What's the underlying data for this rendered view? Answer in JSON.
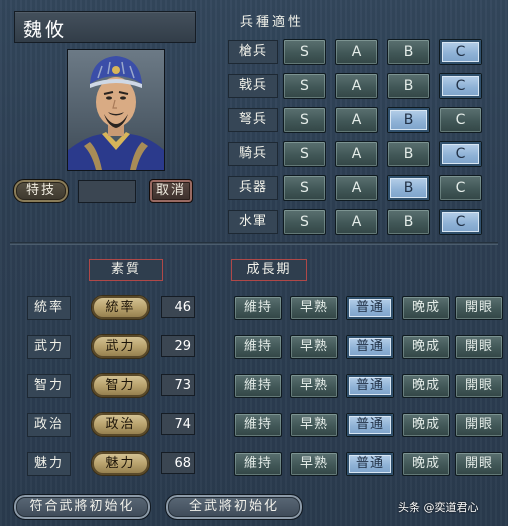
{
  "general": {
    "name": "魏攸"
  },
  "buttons": {
    "special_skill": "特技",
    "cancel": "取消",
    "reset_default": "符合武將初始化",
    "reset_all": "全武將初始化"
  },
  "aptitude": {
    "title": "兵種適性",
    "grades": [
      "S",
      "A",
      "B",
      "C"
    ],
    "rows": [
      {
        "label": "槍兵",
        "selected": "C"
      },
      {
        "label": "戟兵",
        "selected": "C"
      },
      {
        "label": "弩兵",
        "selected": "B"
      },
      {
        "label": "騎兵",
        "selected": "C"
      },
      {
        "label": "兵器",
        "selected": "B"
      },
      {
        "label": "水軍",
        "selected": "C"
      }
    ]
  },
  "sections": {
    "quality": "素質",
    "growth": "成長期"
  },
  "growth_options": [
    "維持",
    "早熟",
    "普通",
    "晚成",
    "開眼"
  ],
  "stats": [
    {
      "label": "統率",
      "button": "統率",
      "value": "46",
      "growth": "普通"
    },
    {
      "label": "武力",
      "button": "武力",
      "value": "29",
      "growth": "普通"
    },
    {
      "label": "智力",
      "button": "智力",
      "value": "73",
      "growth": "普通"
    },
    {
      "label": "政治",
      "button": "政治",
      "value": "74",
      "growth": "普通"
    },
    {
      "label": "魅力",
      "button": "魅力",
      "value": "68",
      "growth": "普通"
    }
  ],
  "watermark": "头条 @奕道君心",
  "colors": {
    "selected": "#8fb2d6",
    "section_border": "#b04848",
    "stat_button": "#b9a36e"
  }
}
